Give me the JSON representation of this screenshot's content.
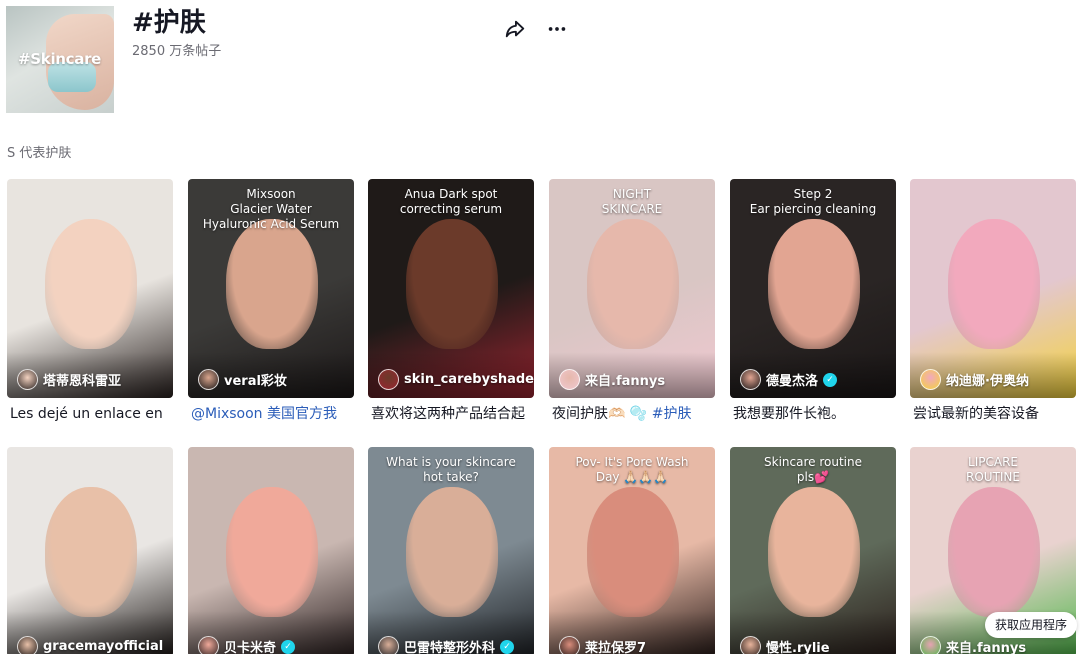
{
  "header": {
    "cover_tag": "#Skincare",
    "title": "#护肤",
    "post_count": "2850 万条帖子",
    "share_icon": "share-icon",
    "more_icon": "more-dots-icon"
  },
  "section_label": "S 代表护肤",
  "videos_row1": [
    {
      "author": "塔蒂恩科雷亚",
      "verified": false,
      "caption": "Les dejé un enlace en",
      "caption_link": "",
      "overlay": "",
      "colors": [
        "#e8e4df",
        "#f3d2c0",
        "#2a2220"
      ]
    },
    {
      "author": "veral彩妆",
      "verified": false,
      "caption": "",
      "caption_link": "@Mixsoon 美国官方我",
      "overlay": "Mixsoon\nGlacier Water\nHyaluronic Acid Serum",
      "colors": [
        "#3b3a38",
        "#d9a58d",
        "#1c1818"
      ]
    },
    {
      "author": "skin_carebyshade",
      "verified": false,
      "caption": "喜欢将这两种产品结合起",
      "caption_link": "",
      "overlay": "Anua Dark spot correcting serum",
      "colors": [
        "#1f1a18",
        "#6b3a2a",
        "#9a2430"
      ]
    },
    {
      "author": "来自.fannys",
      "verified": false,
      "caption": "夜间护肤🫶🏻 🫧 ",
      "caption_link": "#护肤",
      "overlay": "NIGHT\nSKINCARE",
      "colors": [
        "#d9c6c4",
        "#e6b8ab",
        "#f0c8d0"
      ]
    },
    {
      "author": "德曼杰洛",
      "verified": true,
      "caption": "我想要那件长袍。",
      "caption_link": "",
      "overlay": "Step 2\nEar piercing cleaning",
      "colors": [
        "#2a2524",
        "#e2a592",
        "#1a1616"
      ]
    },
    {
      "author": "纳迪娜·伊奥纳",
      "verified": false,
      "caption": "尝试最新的美容设备",
      "caption_link": "",
      "overlay": "",
      "colors": [
        "#e3c7cf",
        "#f2a9bd",
        "#f4d33c"
      ]
    }
  ],
  "videos_row2": [
    {
      "author": "gracemayofficial",
      "verified": false,
      "overlay": "",
      "colors": [
        "#e9e6e3",
        "#e8c0a8",
        "#1d1816"
      ]
    },
    {
      "author": "贝卡米奇",
      "verified": true,
      "overlay": "",
      "colors": [
        "#c9b7b1",
        "#f0a99a",
        "#2b2020"
      ]
    },
    {
      "author": "巴雷特整形外科",
      "verified": true,
      "overlay": "What is your skincare\nhot take?",
      "colors": [
        "#7e8a92",
        "#d9ae98",
        "#1f2226"
      ]
    },
    {
      "author": "莱拉保罗7",
      "verified": false,
      "overlay": "Pov- It's Pore Wash\nDay 🙏🏻🙏🏻🙏🏻",
      "colors": [
        "#e7b9a6",
        "#d98d7c",
        "#2a1d1a"
      ]
    },
    {
      "author": "慢性.rylie",
      "verified": false,
      "overlay": "Skincare routine\npls💕",
      "colors": [
        "#5f6a5a",
        "#e8b49c",
        "#2b1f1b"
      ]
    },
    {
      "author": "来自.fannys",
      "verified": false,
      "overlay": "LIPCARE\nROUTINE",
      "colors": [
        "#e9d2cf",
        "#e7a3b3",
        "#4fb74a"
      ]
    }
  ],
  "get_app_label": "获取应用程序"
}
